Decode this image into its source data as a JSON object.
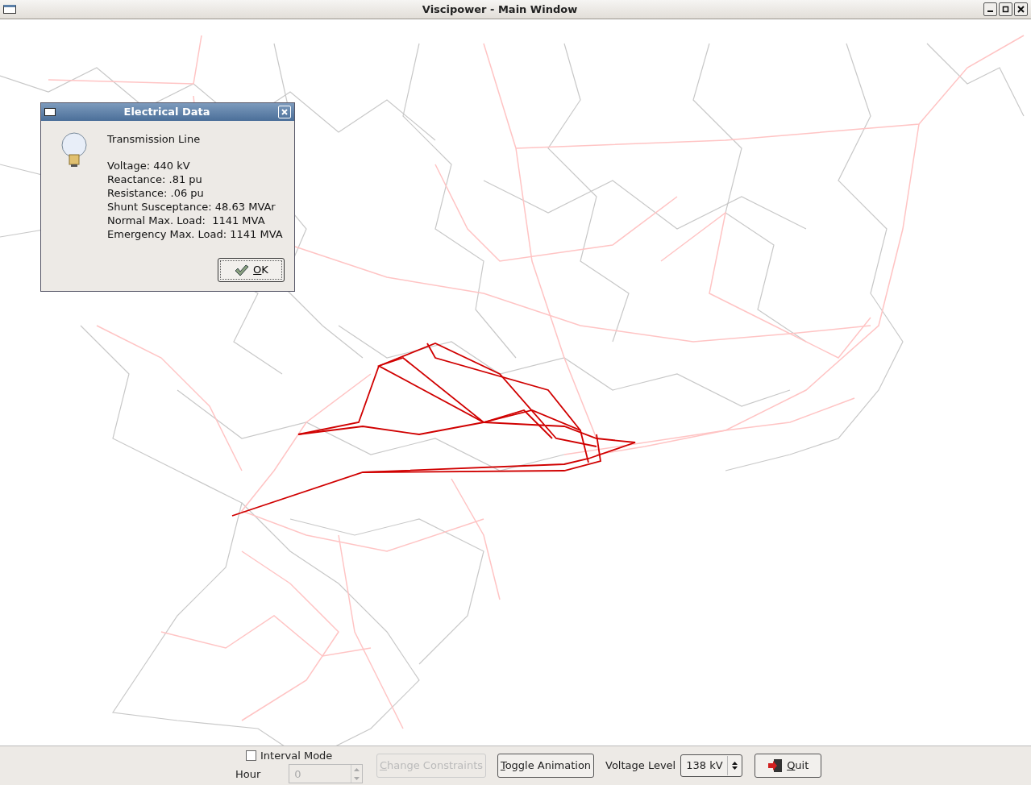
{
  "window": {
    "title": "Viscipower - Main Window"
  },
  "dialog": {
    "title": "Electrical Data",
    "heading": "Transmission Line",
    "lines": [
      "Voltage: 440 kV",
      "Reactance: .81 pu",
      "Resistance: .06 pu",
      "Shunt Susceptance: 48.63 MVAr",
      "Normal Max. Load:  1141 MVA",
      "Emergency Max. Load: 1141 MVA"
    ],
    "ok_button": "OK"
  },
  "controls": {
    "interval_mode": {
      "label": "Interval Mode",
      "checked": false
    },
    "hour": {
      "label": "Hour",
      "value": "0",
      "disabled": true
    },
    "change_constraints": {
      "label": "Change Constraints",
      "disabled": true
    },
    "toggle_animation": {
      "label": "Toggle Animation"
    },
    "voltage_level": {
      "label": "Voltage Level",
      "value": "138 kV"
    },
    "quit": {
      "label": "Quit"
    }
  }
}
